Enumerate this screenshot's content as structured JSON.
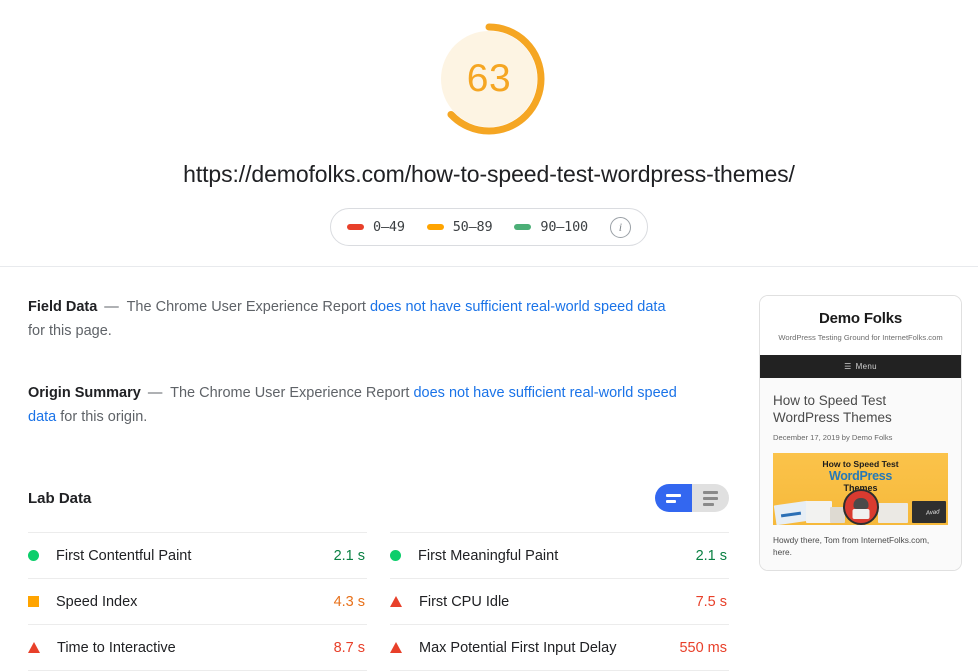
{
  "score": {
    "value": "63",
    "percent": 63,
    "color": "#f5a623",
    "track_color": "#fdf4e3"
  },
  "page_url": "https://demofolks.com/how-to-speed-test-wordpress-themes/",
  "legend": {
    "items": [
      {
        "label": "0–49",
        "color": "#e8402a",
        "name": "legend-red"
      },
      {
        "label": "50–89",
        "color": "#ffa400",
        "name": "legend-orange"
      },
      {
        "label": "90–100",
        "color": "#4caf77",
        "name": "legend-green"
      }
    ],
    "info_glyph": "i"
  },
  "field_data": {
    "title": "Field Data",
    "dash": "—",
    "text_before": "The Chrome User Experience Report",
    "link": "does not have sufficient real-world speed data",
    "text_after": "for this page."
  },
  "origin_summary": {
    "title": "Origin Summary",
    "dash": "—",
    "text_before": "The Chrome User Experience Report",
    "link": "does not have sufficient real-world speed data",
    "text_after": "for this origin."
  },
  "lab_data": {
    "title": "Lab Data",
    "toggle": {
      "active": "filmstrip-view",
      "inactive": "list-view"
    },
    "columns": [
      {
        "metrics": [
          {
            "name": "First Contentful Paint",
            "value": "2.1 s",
            "status": "pass",
            "icon": "circle",
            "value_class": "val-green"
          },
          {
            "name": "Speed Index",
            "value": "4.3 s",
            "status": "average",
            "icon": "square",
            "value_class": "val-orange"
          },
          {
            "name": "Time to Interactive",
            "value": "8.7 s",
            "status": "fail",
            "icon": "triangle",
            "value_class": "val-red"
          }
        ]
      },
      {
        "metrics": [
          {
            "name": "First Meaningful Paint",
            "value": "2.1 s",
            "status": "pass",
            "icon": "circle",
            "value_class": "val-green"
          },
          {
            "name": "First CPU Idle",
            "value": "7.5 s",
            "status": "fail",
            "icon": "triangle",
            "value_class": "val-red"
          },
          {
            "name": "Max Potential First Input Delay",
            "value": "550 ms",
            "status": "fail",
            "icon": "triangle",
            "value_class": "val-red"
          }
        ]
      }
    ]
  },
  "thumbnail": {
    "site_title": "Demo Folks",
    "site_tagline": "WordPress Testing Ground for InternetFolks.com",
    "menu_label": "Menu",
    "menu_glyph": "☰",
    "post_title": "How to Speed Test WordPress Themes",
    "post_meta": "December 17, 2019 by Demo Folks",
    "feature_line1": "How to Speed Test",
    "feature_line2": "WordPress",
    "feature_line3": "Themes",
    "feature_badge": "Avad",
    "footer_text": "Howdy there, Tom from InternetFolks.com, here."
  }
}
